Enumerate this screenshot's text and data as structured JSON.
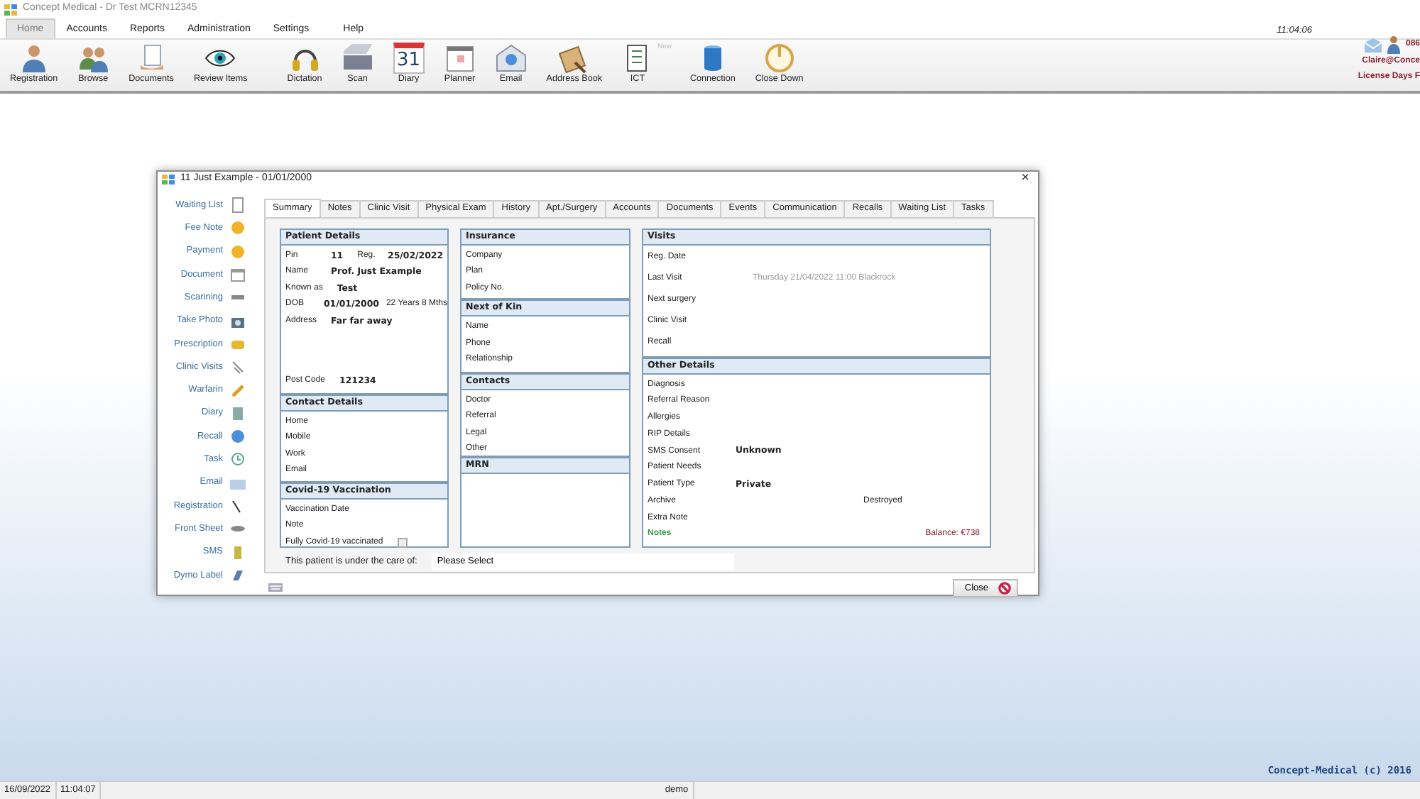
{
  "app": {
    "title": "Concept Medical - Dr Test  MCRN12345",
    "clock": "11:04:06"
  },
  "menu": [
    {
      "label": "Home",
      "selected": true
    },
    {
      "label": "Accounts",
      "selected": false
    },
    {
      "label": "Reports",
      "selected": false
    },
    {
      "label": "Administration",
      "selected": false
    },
    {
      "label": "Settings",
      "selected": false
    },
    {
      "label": "Help",
      "selected": false
    }
  ],
  "toolbar": [
    {
      "label": "Registration"
    },
    {
      "label": "Browse"
    },
    {
      "label": "Documents"
    },
    {
      "label": "Review Items"
    },
    {
      "label": "Dictation"
    },
    {
      "label": "Scan"
    },
    {
      "label": "Diary",
      "icon_text": "31"
    },
    {
      "label": "Planner"
    },
    {
      "label": "Email"
    },
    {
      "label": "Address Book"
    },
    {
      "label": "ICT",
      "badge": "New"
    },
    {
      "label": "Connection"
    },
    {
      "label": "Close Down"
    }
  ],
  "user_panel": {
    "phone": "086",
    "user": "Claire@Conce",
    "license": "License Days F"
  },
  "dialog": {
    "title": "11  Just Example -  01/01/2000",
    "close_glyph": "×",
    "sidebar": [
      {
        "label": "Waiting List"
      },
      {
        "label": "Fee Note"
      },
      {
        "label": "Payment"
      },
      {
        "label": "Document"
      },
      {
        "label": "Scanning"
      },
      {
        "label": "Take Photo"
      },
      {
        "label": "Prescription"
      },
      {
        "label": "Clinic Visits"
      },
      {
        "label": "Warfarin"
      },
      {
        "label": "Diary"
      },
      {
        "label": "Recall"
      },
      {
        "label": "Task"
      },
      {
        "label": "Email"
      },
      {
        "label": "Registration"
      },
      {
        "label": "Front Sheet"
      },
      {
        "label": "SMS"
      },
      {
        "label": "Dymo Label"
      }
    ],
    "tabs": [
      {
        "label": "Summary",
        "selected": true
      },
      {
        "label": "Notes",
        "selected": false
      },
      {
        "label": "Clinic Visit",
        "selected": false
      },
      {
        "label": "Physical Exam",
        "selected": false
      },
      {
        "label": "History",
        "selected": false
      },
      {
        "label": "Apt./Surgery",
        "selected": false
      },
      {
        "label": "Accounts",
        "selected": false
      },
      {
        "label": "Documents",
        "selected": false
      },
      {
        "label": "Events",
        "selected": false
      },
      {
        "label": "Communication",
        "selected": false
      },
      {
        "label": "Recalls",
        "selected": false
      },
      {
        "label": "Waiting List",
        "selected": false
      },
      {
        "label": "Tasks",
        "selected": false
      }
    ],
    "columns": [
      [
        {
          "title": "Patient Details",
          "rows": [
            {
              "kind": "fields",
              "cells": [
                {
                  "label": "Pin",
                  "value": "11",
                  "kind": "strong"
                },
                {
                  "label": "Reg.",
                  "value": "25/02/2022",
                  "kind": "strong"
                }
              ]
            },
            {
              "kind": "fields",
              "cells": [
                {
                  "label": "Name",
                  "value": "Prof. Just Example",
                  "kind": "strong"
                }
              ]
            },
            {
              "kind": "fields",
              "cells": [
                {
                  "label": "Known as",
                  "value": "Test",
                  "kind": "strong"
                }
              ]
            },
            {
              "kind": "fields",
              "cells": [
                {
                  "label": "DOB",
                  "value": "01/01/2000",
                  "kind": "strong",
                  "extra": "22 Years 8 Mths"
                }
              ]
            },
            {
              "kind": "fields",
              "cells": [
                {
                  "label": "Address",
                  "value": "Far far away",
                  "kind": "strong"
                }
              ]
            },
            {
              "kind": "fields",
              "cells": [
                {
                  "label": "Post Code",
                  "value": "121234",
                  "kind": "strong"
                }
              ]
            }
          ]
        },
        {
          "title": "Contact Details",
          "rows": [
            {
              "kind": "fields",
              "cells": [
                {
                  "label": "Home"
                }
              ]
            },
            {
              "kind": "fields",
              "cells": [
                {
                  "label": "Mobile"
                }
              ]
            },
            {
              "kind": "fields",
              "cells": [
                {
                  "label": "Work"
                }
              ]
            },
            {
              "kind": "fields",
              "cells": [
                {
                  "label": "Email"
                }
              ]
            }
          ]
        },
        {
          "title": "Covid-19 Vaccination",
          "rows": [
            {
              "kind": "fields",
              "cells": [
                {
                  "label": "Vaccination Date"
                }
              ]
            },
            {
              "kind": "fields",
              "cells": [
                {
                  "label": "Note"
                }
              ]
            },
            {
              "kind": "checkbox",
              "label": "Fully Covid-19 vaccinated",
              "checked": false
            }
          ]
        }
      ],
      [
        {
          "title": "Insurance",
          "rows": [
            {
              "kind": "fields",
              "cells": [
                {
                  "label": "Company"
                }
              ]
            },
            {
              "kind": "fields",
              "cells": [
                {
                  "label": "Plan"
                }
              ]
            },
            {
              "kind": "fields",
              "cells": [
                {
                  "label": "Policy No."
                }
              ]
            }
          ]
        },
        {
          "title": "Next of Kin",
          "rows": [
            {
              "kind": "fields",
              "cells": [
                {
                  "label": "Name"
                }
              ]
            },
            {
              "kind": "fields",
              "cells": [
                {
                  "label": "Phone"
                }
              ]
            },
            {
              "kind": "fields",
              "cells": [
                {
                  "label": "Relationship"
                }
              ]
            }
          ]
        },
        {
          "title": "Contacts",
          "rows": [
            {
              "kind": "fields",
              "cells": [
                {
                  "label": "Doctor"
                }
              ]
            },
            {
              "kind": "fields",
              "cells": [
                {
                  "label": "Referral"
                }
              ]
            },
            {
              "kind": "fields",
              "cells": [
                {
                  "label": "Legal"
                }
              ]
            },
            {
              "kind": "fields",
              "cells": [
                {
                  "label": "Other"
                }
              ]
            }
          ]
        },
        {
          "title": "MRN"
        }
      ],
      [
        {
          "title": "Visits",
          "rows": [
            {
              "kind": "fields",
              "cells": [
                {
                  "label": "Reg. Date"
                }
              ]
            },
            {
              "kind": "fields",
              "cells": [
                {
                  "label": "Last Visit",
                  "value": "Thursday 21/04/2022 11:00 Blackrock",
                  "kind": "muted"
                }
              ]
            },
            {
              "kind": "fields",
              "cells": [
                {
                  "label": "Next surgery"
                }
              ]
            },
            {
              "kind": "fields",
              "cells": [
                {
                  "label": "Clinic Visit"
                }
              ]
            },
            {
              "kind": "fields",
              "cells": [
                {
                  "label": "Recall"
                }
              ]
            }
          ]
        },
        {
          "title": "Other Details",
          "rows": [
            {
              "kind": "fields",
              "cells": [
                {
                  "label": "Diagnosis"
                }
              ]
            },
            {
              "kind": "fields",
              "cells": [
                {
                  "label": "Referral Reason"
                }
              ]
            },
            {
              "kind": "fields",
              "cells": [
                {
                  "label": "Allergies"
                }
              ]
            },
            {
              "kind": "fields",
              "cells": [
                {
                  "label": "RIP Details"
                }
              ]
            },
            {
              "kind": "fields",
              "cells": [
                {
                  "label": "SMS Consent",
                  "value": "Unknown",
                  "kind": "strong"
                }
              ]
            },
            {
              "kind": "fields",
              "cells": [
                {
                  "label": "Patient Needs"
                }
              ]
            },
            {
              "kind": "fields",
              "cells": [
                {
                  "label": "Patient Type",
                  "value": "Private",
                  "kind": "strong"
                }
              ]
            },
            {
              "kind": "fields",
              "cells": [
                {
                  "label": "Archive",
                  "value": "Destroyed",
                  "kind": "plain"
                }
              ]
            },
            {
              "kind": "fields",
              "cells": [
                {
                  "label": "Extra Note"
                }
              ]
            },
            {
              "kind": "footer",
              "link": "Notes",
              "balance": "Balance:  €738"
            }
          ]
        }
      ]
    ],
    "care": {
      "label": "This patient is under the care of:",
      "value": "Please Select"
    },
    "close_button": "Close"
  },
  "copyright": "Concept-Medical (c) 2016",
  "status_bar": [
    "16/09/2022",
    "11:04:07",
    "demo"
  ]
}
